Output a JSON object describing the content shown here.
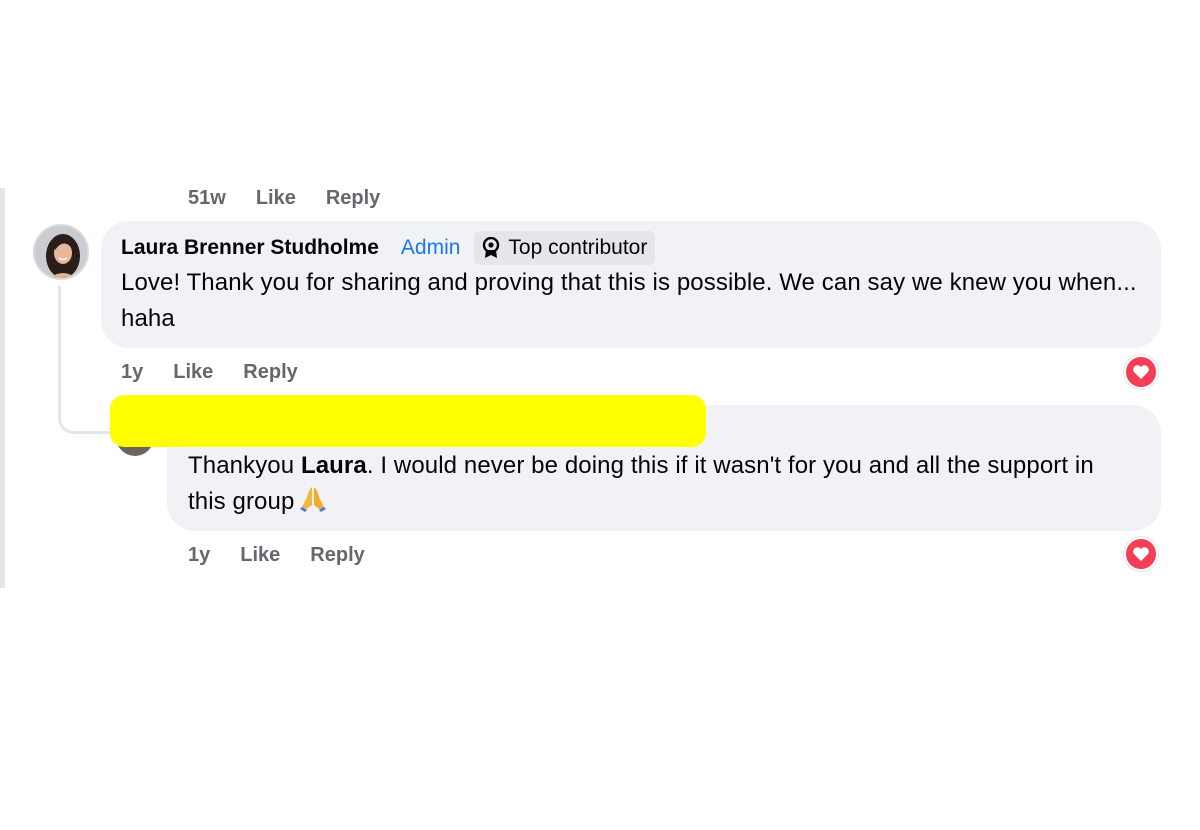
{
  "colors": {
    "bubble_bg": "#f0f2f5",
    "meta_text": "#65676b",
    "admin_blue": "#1877f2",
    "redaction_yellow": "#ffff00",
    "love_red": "#f33e58"
  },
  "top_actions": {
    "time": "51w",
    "like": "Like",
    "reply": "Reply"
  },
  "comment": {
    "author": "Laura Brenner Studholme",
    "admin_badge": "Admin",
    "contributor_badge": "Top contributor",
    "contributor_icon": "badge-icon",
    "text": "Love! Thank you for sharing and proving that this is possible. We can say we knew you when... haha",
    "time": "1y",
    "like": "Like",
    "reply": "Reply",
    "reaction_icon": "love-icon"
  },
  "reply": {
    "author_redacted": true,
    "text_before": "Thankyou ",
    "mention": "Laura",
    "text_after": ". I would never be doing this if it wasn't for you and all the support in this group",
    "emoji": "folded-hands-icon",
    "time": "1y",
    "like": "Like",
    "reply": "Reply",
    "reaction_icon": "love-icon"
  }
}
